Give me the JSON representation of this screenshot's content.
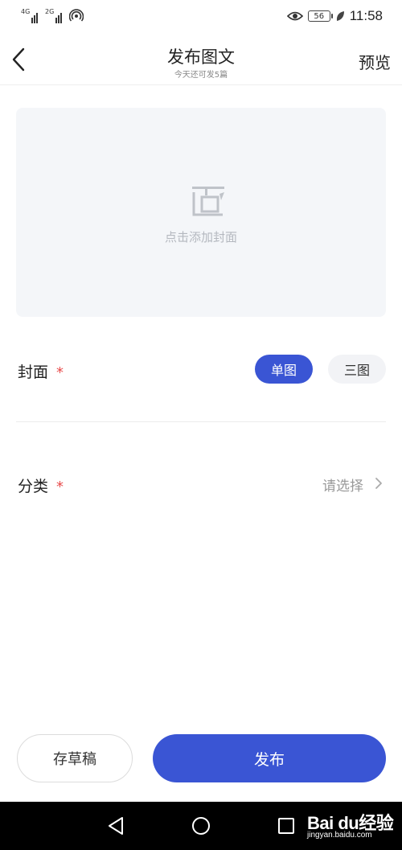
{
  "status_bar": {
    "network_1": "4G",
    "network_2": "2G",
    "battery": "56",
    "time": "11:58"
  },
  "nav": {
    "title": "发布图文",
    "subtitle": "今天还可发5篇",
    "preview": "预览"
  },
  "cover_area": {
    "hint": "点击添加封面"
  },
  "cover_row": {
    "label": "封面",
    "required_mark": "*",
    "options": [
      "单图",
      "三图"
    ],
    "selected": "单图"
  },
  "category_row": {
    "label": "分类",
    "required_mark": "*",
    "placeholder": "请选择"
  },
  "actions": {
    "draft": "存草稿",
    "publish": "发布"
  },
  "watermark": {
    "logo": "Bai du经验",
    "site": "jingyan.baidu.com"
  },
  "colors": {
    "accent": "#3a55d4",
    "required": "#e84b4b",
    "cover_bg": "#f4f6f9"
  }
}
